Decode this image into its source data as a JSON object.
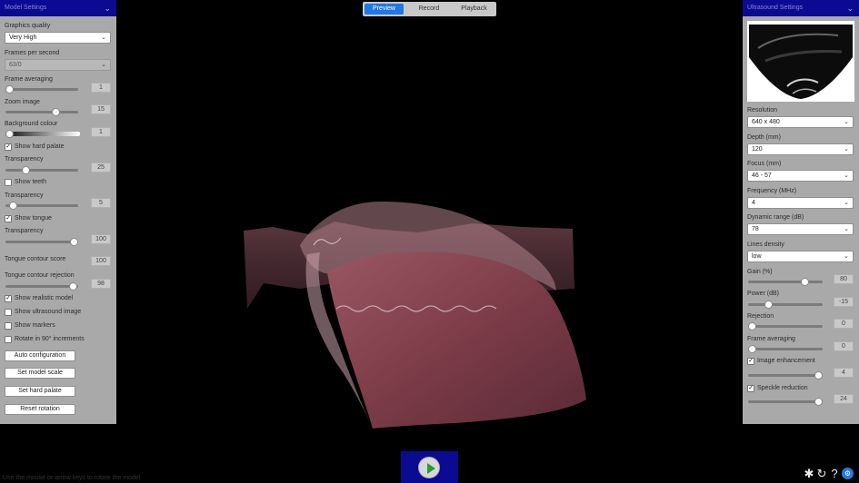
{
  "tabs": [
    {
      "label": "Preview",
      "active": true
    },
    {
      "label": "Record",
      "active": false
    },
    {
      "label": "Playback",
      "active": false
    }
  ],
  "model_settings": {
    "title": "Model Settings",
    "graphics_quality_label": "Graphics quality",
    "graphics_quality_value": "Very High",
    "fps_label": "Frames per second",
    "fps_value": "63/0",
    "frame_averaging_label": "Frame averaging",
    "frame_averaging_value": "1",
    "frame_averaging_level": 0.0,
    "zoom_label": "Zoom image",
    "zoom_value": "15",
    "zoom_level": 0.72,
    "background_label": "Background colour",
    "background_value": "1",
    "background_level": 0.0,
    "show_hard_palate_label": "Show hard palate",
    "show_hard_palate_checked": true,
    "transparency1_label": "Transparency",
    "transparency1_value": "25",
    "transparency1_level": 0.25,
    "show_teeth_label": "Show teeth",
    "show_teeth_checked": false,
    "transparency2_label": "Transparency",
    "transparency2_value": "5",
    "transparency2_level": 0.05,
    "show_tongue_label": "Show tongue",
    "show_tongue_checked": true,
    "transparency3_label": "Transparency",
    "transparency3_value": "100",
    "transparency3_level": 1.0,
    "contour_score_label": "Tongue contour score",
    "contour_score_value": "100",
    "contour_rejection_label": "Tongue contour rejection",
    "contour_rejection_value": "98",
    "contour_rejection_level": 0.98,
    "realistic_label": "Show realistic model",
    "realistic_checked": true,
    "us_image_label": "Show ultrasound image",
    "us_image_checked": false,
    "markers_label": "Show markers",
    "markers_checked": false,
    "rotate_label": "Rotate in 90° increments",
    "rotate_checked": false,
    "auto_config_label": "Auto configuration",
    "set_scale_label": "Set model scale",
    "set_palate_label": "Set hard palate",
    "reset_rotation_label": "Reset rotation"
  },
  "ultrasound_settings": {
    "title": "Ultrasound Settings",
    "resolution_label": "Resolution",
    "resolution_value": "640 x 480",
    "depth_label": "Depth (mm)",
    "depth_value": "120",
    "focus_label": "Focus (mm)",
    "focus_value": "46 - 57",
    "frequency_label": "Frequency (MHz)",
    "frequency_value": "4",
    "dynamic_range_label": "Dynamic range (dB)",
    "dynamic_range_value": "78",
    "lines_density_label": "Lines density",
    "lines_density_value": "low",
    "gain_label": "Gain (%)",
    "gain_value": "80",
    "gain_level": 0.8,
    "power_label": "Power (dB)",
    "power_value": "-15",
    "power_level": 0.25,
    "rejection_label": "Rejection",
    "rejection_value": "0",
    "rejection_level": 0.0,
    "frame_avg_label": "Frame averaging",
    "frame_avg_value": "0",
    "frame_avg_level": 0.0,
    "enhancement_label": "Image enhancement",
    "enhancement_checked": true,
    "enhancement_value": "4",
    "enhancement_level": 1.0,
    "speckle_label": "Speckle reduction",
    "speckle_checked": true,
    "speckle_value": "24",
    "speckle_level": 1.0
  },
  "hint": "Use the mouse or arrow keys to rotate the model",
  "icons": {
    "settings": "asterisk-icon",
    "refresh": "refresh-icon",
    "help": "question-icon",
    "badge": "help-badge-icon"
  },
  "colors": {
    "panel_bg": "#a9a9a9",
    "header_bg": "#0a0a92",
    "tab_active": "#1e78e8",
    "tongue": "#8a4a55"
  }
}
